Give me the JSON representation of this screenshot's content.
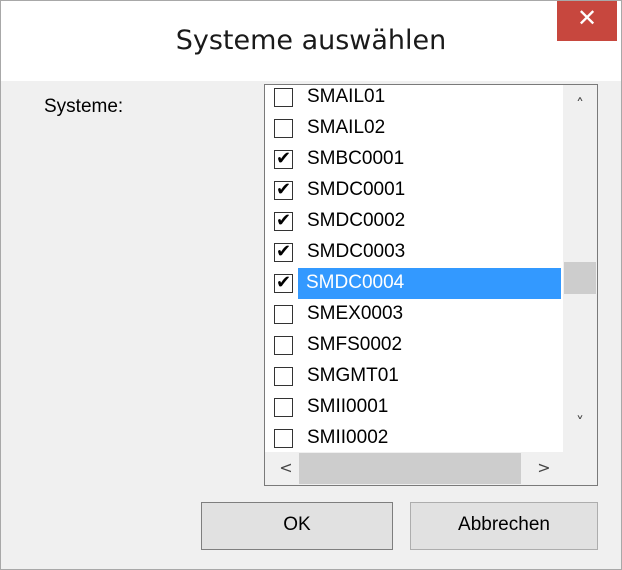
{
  "window": {
    "title": "Systeme auswählen",
    "close_glyph": "✕"
  },
  "form": {
    "label": "Systeme:"
  },
  "list": {
    "items": [
      {
        "label": "SMAIL01",
        "checked": false,
        "selected": false
      },
      {
        "label": "SMAIL02",
        "checked": false,
        "selected": false
      },
      {
        "label": "SMBC0001",
        "checked": true,
        "selected": false
      },
      {
        "label": "SMDC0001",
        "checked": true,
        "selected": false
      },
      {
        "label": "SMDC0002",
        "checked": true,
        "selected": false
      },
      {
        "label": "SMDC0003",
        "checked": true,
        "selected": false
      },
      {
        "label": "SMDC0004",
        "checked": true,
        "selected": true
      },
      {
        "label": "SMEX0003",
        "checked": false,
        "selected": false
      },
      {
        "label": "SMFS0002",
        "checked": false,
        "selected": false
      },
      {
        "label": "SMGMT01",
        "checked": false,
        "selected": false
      },
      {
        "label": "SMII0001",
        "checked": false,
        "selected": false
      },
      {
        "label": "SMII0002",
        "checked": false,
        "selected": false
      }
    ],
    "check_glyph": "✔",
    "scroll_up": "˄",
    "scroll_down": "˅",
    "scroll_left": "<",
    "scroll_right": ">"
  },
  "buttons": {
    "ok": "OK",
    "cancel": "Abbrechen"
  },
  "colors": {
    "selection": "#3399ff",
    "close": "#c7473e"
  }
}
